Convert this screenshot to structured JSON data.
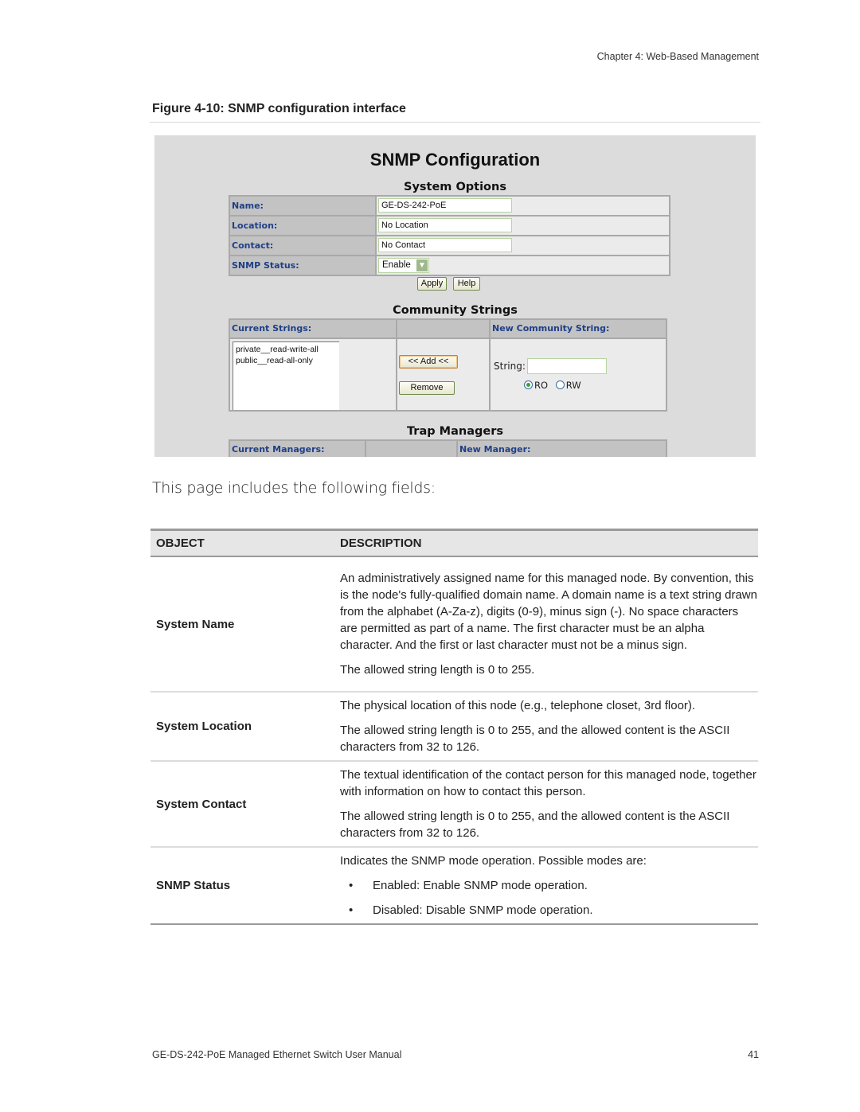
{
  "header": {
    "chapter": "Chapter 4: Web-Based Management"
  },
  "figure": {
    "caption": "Figure 4-10:  SNMP configuration interface"
  },
  "snmp_ui": {
    "title": "SNMP Configuration",
    "system_options": {
      "title": "System Options",
      "rows": [
        {
          "label": "Name:",
          "value": "GE-DS-242-PoE"
        },
        {
          "label": "Location:",
          "value": "No Location"
        },
        {
          "label": "Contact:",
          "value": "No Contact"
        },
        {
          "label": "SNMP Status:",
          "value": "Enable"
        }
      ],
      "apply_label": "Apply",
      "help_label": "Help"
    },
    "community_strings": {
      "title": "Community Strings",
      "current_header": "Current Strings:",
      "new_header": "New Community String:",
      "entries": [
        "private__read-write-all",
        "public__read-all-only"
      ],
      "add_label": "<< Add <<",
      "remove_label": "Remove",
      "string_label": "String:",
      "string_value": "",
      "radio_ro": "RO",
      "radio_rw": "RW",
      "selected_access": "RO"
    },
    "trap_managers": {
      "title": "Trap Managers",
      "current_header": "Current Managers:",
      "new_header": "New Manager:"
    }
  },
  "intro": "This page includes the following fields:",
  "table": {
    "headers": {
      "object": "OBJECT",
      "description": "DESCRIPTION"
    },
    "rows": [
      {
        "object": "System Name",
        "paragraphs": [
          "An administratively assigned name for this managed node. By convention, this is the node's fully-qualified domain name. A domain name is a text string drawn from the alphabet (A-Za-z), digits (0-9), minus sign (-). No space characters are permitted as part of a name. The first character must be an alpha character. And the first or last character must not be a minus sign.",
          "The allowed string length is 0 to 255."
        ]
      },
      {
        "object": "System Location",
        "paragraphs": [
          "The physical location of this node (e.g., telephone closet, 3rd floor).",
          "The allowed string length is 0 to 255, and the allowed content is the ASCII characters from 32 to 126."
        ]
      },
      {
        "object": "System Contact",
        "paragraphs": [
          "The textual identification of the contact person for this managed node, together with information on how to contact this person.",
          "The allowed string length is 0 to 255, and the allowed content is the ASCII characters from 32 to 126."
        ]
      },
      {
        "object": "SNMP Status",
        "paragraphs": [
          "Indicates the SNMP mode operation. Possible modes are:"
        ],
        "bullets": [
          "Enabled: Enable SNMP mode operation.",
          "Disabled: Disable SNMP mode operation."
        ]
      }
    ]
  },
  "footer": {
    "manual_title": "GE-DS-242-PoE Managed Ethernet Switch User Manual",
    "page_number": "41"
  }
}
